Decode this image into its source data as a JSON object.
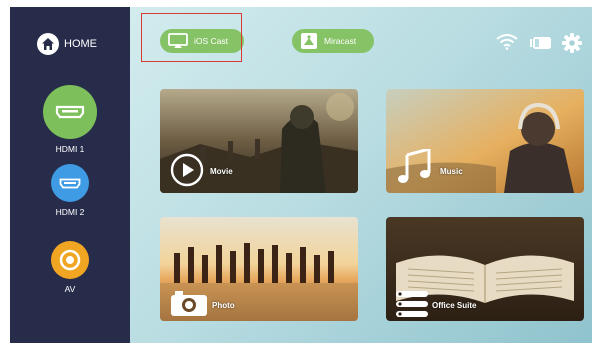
{
  "sidebar": {
    "home_label": "HOME",
    "sources": [
      {
        "label": "HDMI 1",
        "color": "#7dbf5a"
      },
      {
        "label": "HDMI 2",
        "color": "#3f9be3"
      },
      {
        "label": "AV",
        "color": "#f0a623"
      }
    ]
  },
  "topbar": {
    "ios_cast_label": "iOS Cast",
    "miracast_label": "Miracast",
    "pill_color": "#86c266",
    "highlight_color": "#d93a33"
  },
  "tiles": {
    "movie": "Movie",
    "music": "Music",
    "photo": "Photo",
    "office": "Office Suite"
  }
}
